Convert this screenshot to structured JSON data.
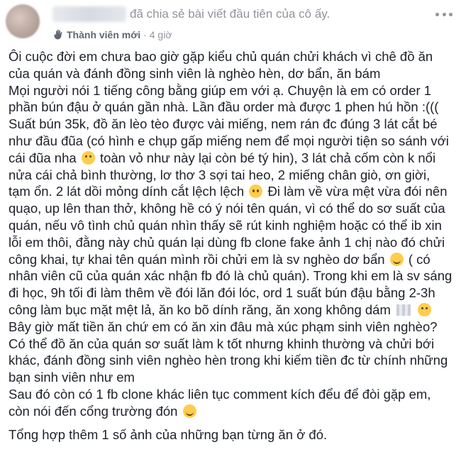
{
  "header": {
    "shared_text": "đã chia sẻ bài viết đầu tiên của cô ấy.",
    "badge": "Thành viên mới",
    "separator": "·",
    "time": "4 giờ",
    "icons": {
      "avatar": "blurred-avatar",
      "badge": "waving-hand-icon",
      "more": "more-options-icon"
    }
  },
  "post": {
    "p1_l1": "Ôi cuộc đời em chưa bao giờ gặp kiểu chủ quán chửi khách vì chê đồ ăn",
    "p1_l2": "của quán và đánh đồng sinh viên là nghèo hèn, dơ bẩn, ăn bám",
    "p1_l3": "Mọi người nói 1 tiếng công bằng giúp em với ạ. Chuyện là em có order 1",
    "p1_l4": "phần bún đậu ở quán gần nhà. Lần đầu order mà được 1 phen hú hồn :(((",
    "p1_l5": "Suất bún 35k, đồ ăn lèo tèo được vài miếng, nem rán đc đúng 3 lát cắt bé",
    "p1_l6": "như đầu đũa (có hình e chụp gấp miếng nem để mọi người tiện so sánh với",
    "p1_l7a": "cái đũa nha",
    "p1_l7b": "toàn vỏ như này lại còn bé tý hin), 3 lát chả cốm còn k nổi",
    "p1_l8": "nửa cái chả bình thường, lơ thơ 3 sợi tai heo, 2 miếng chân giò, ơn giời,",
    "p1_l9a": "tạm ổn. 2 lát dồi mỏng dính cắt lệch lệch",
    "p1_l9b": "Đi làm về vừa mệt vừa đói nên",
    "p1_l10": "quạo, up lên than thở, không hề có ý nói tên quán, vì có thể do sơ suất của",
    "p1_l11": "quán, nếu vô tình chủ quán nhìn thấy sẽ rút kinh nghiệm hoặc có thể ib xin",
    "p1_l12": "lỗi em thôi, đằng này chủ quán lại dùng fb clone fake ảnh 1 chị nào đó chửi",
    "p1_l13a": "công khai, tự khai tên quán mình rồi chửi em là sv nghèo dơ bẩn",
    "p1_l13b": "( có",
    "p1_l14": "nhân viên cũ của quán xác nhận fb đó là chủ quán). Trong khi em là sv sáng",
    "p1_l15": "đi học, 9h tối đi làm thêm về đói lăn đói lóc, ord 1 suất bún đậu bằng 2-3h",
    "p1_l16": "công làm bục mặt mệt lả, ăn ko bõ dính răng, ăn xong không dám",
    "p1_l17": "Bây giờ mất tiền ăn chứ em có ăn xin đâu mà xúc phạm sinh viên nghèo?",
    "p1_l18": "Có thể đồ ăn của quán sơ suất làm k tốt nhưng khinh thường và chửi bới",
    "p1_l19": "khác, đánh đồng sinh viên nghèo hèn trong khi kiếm tiền đc từ chính những",
    "p1_l20": "bạn sinh viên như em",
    "p1_l21": "Sau đó còn có 1 fb clone khác liên tục comment kích đểu để đòi gặp em,",
    "p1_l22": "còn nói đến cổng trường đón",
    "p2": "Tổng hợp thêm 1 số ảnh của những bạn từng ăn ở đó."
  }
}
